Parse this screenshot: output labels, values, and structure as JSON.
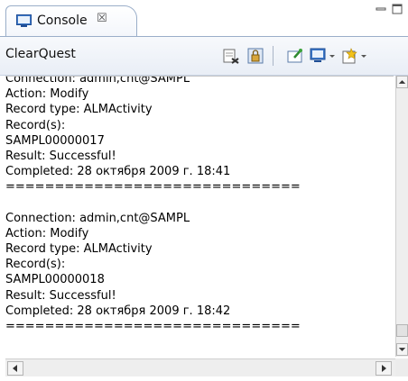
{
  "tab": {
    "label": "Console",
    "close_glyph": "☒",
    "icon": "console-icon"
  },
  "window_controls": {
    "minimize_icon": "minimize-icon",
    "maximize_icon": "maximize-icon"
  },
  "toolbar": {
    "title": "ClearQuest",
    "icons": [
      "clear-console-icon",
      "scroll-lock-icon",
      "pin-console-icon",
      "display-console-icon",
      "dropdown-arrow-icon",
      "new-console-icon",
      "dropdown-arrow-icon"
    ]
  },
  "console": {
    "lines": [
      "Connection: admin,cnt@SAMPL",
      "Action: Modify",
      "Record type: ALMActivity",
      "Record(s):",
      "SAMPL00000017",
      "Result: Successful!",
      "Completed: 28 октября 2009 г. 18:41",
      "==============================",
      "",
      "Connection: admin,cnt@SAMPL",
      "Action: Modify",
      "Record type: ALMActivity",
      "Record(s):",
      "SAMPL00000018",
      "Result: Successful!",
      "Completed: 28 октября 2009 г. 18:42",
      "=============================="
    ]
  },
  "colors": {
    "border": "#9aaec9",
    "toolbar_bg": "#e9eef6",
    "text": "#000000"
  }
}
